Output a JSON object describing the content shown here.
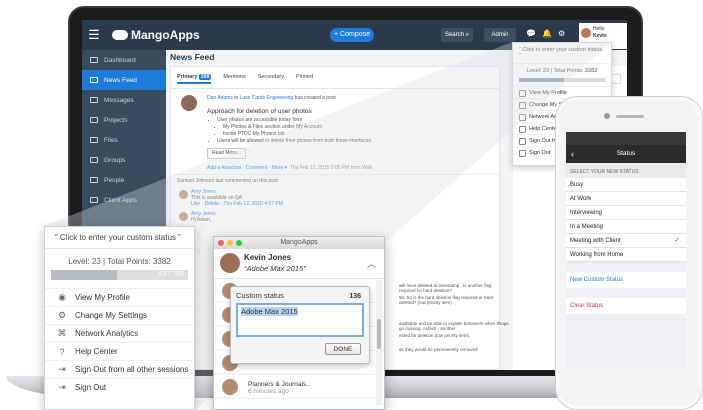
{
  "app": {
    "logo": "MangoApps",
    "compose": "+ Compose",
    "search": "Search",
    "admin": "Admin",
    "hello": "Hello",
    "user": "Kevin"
  },
  "sidebar": {
    "items": [
      {
        "label": "Dashboard",
        "active": false
      },
      {
        "label": "News Feed",
        "active": true
      },
      {
        "label": "Messages",
        "active": false
      },
      {
        "label": "Projects",
        "active": false
      },
      {
        "label": "Files",
        "active": false
      },
      {
        "label": "Groups",
        "active": false
      },
      {
        "label": "People",
        "active": false
      },
      {
        "label": "Client Apps",
        "active": false
      }
    ]
  },
  "feed": {
    "title": "News Feed",
    "tabs": {
      "primary": "Primary",
      "primary_count": "298",
      "mentions": "Mentions",
      "secondary": "Secondary",
      "pinned": "Pinned"
    },
    "post": {
      "author": "Dan Adams",
      "in": "in",
      "team": "Luxe Cards Engineering",
      "action": "has created a post",
      "title": "Approach for deletion of user photos",
      "bullets": [
        "User photos are accessible today form",
        "My Photos & Files section under My Account",
        "Inside PTDC My Photos tab",
        "Users will be allowed to delete their photos from both these interfaces."
      ],
      "read_more": "Read More...",
      "reactions": "Add a Reaction · Comment · More ▾",
      "meta": "Thu Feb 12, 2015 3:05 PM from Web"
    },
    "last_comment": "Samuel Johnson last commented on this post",
    "comments": [
      {
        "author": "Amy Jones",
        "text": "This is available on QA",
        "links": "Like · Delete · Thu Feb 12, 2015 4:07 PM"
      },
      {
        "author": "Amy Jones",
        "text": "Hi Adam,",
        "links": ""
      }
    ],
    "right_text": [
      "will have deleted at timestamp . Is another flag required for hard deletion?",
      "50. So is the hard deletion flag required or hard deleted? (low priority item)",
      "auditable and be able to explain behaviors when things go missing. Ashish - another",
      "ested for deletion (low priority item).",
      "as they would be permanently removed"
    ]
  },
  "small_status": {
    "custom": "“ Click to enter your custom status ”",
    "level": "Level: 23",
    "points": "Total Points: 3382",
    "items": [
      "View My Profile",
      "Change My Settings",
      "Network Analytics",
      "Help Center",
      "Sign Out from",
      "Sign Out"
    ]
  },
  "status_menu": {
    "custom": "“ Click to enter your custom status ”",
    "level": "Level: 23",
    "points": "Total Points: 3382",
    "bar_label": "53 / 758",
    "level_progress": 0.48,
    "items": [
      {
        "label": "View My Profile",
        "icon": "profile-icon"
      },
      {
        "label": "Change My Settings",
        "icon": "gear-icon"
      },
      {
        "label": "Network Analytics",
        "icon": "analytics-icon"
      },
      {
        "label": "Help Center",
        "icon": "help-icon"
      },
      {
        "label": "Sign Out from all other sessions",
        "icon": "signout-all-icon"
      },
      {
        "label": "Sign Out",
        "icon": "signout-icon"
      }
    ]
  },
  "chat": {
    "window_title": "MangoApps",
    "name": "Kevin Jones",
    "status": "“Adobe Max 2015”",
    "rows": [
      {
        "title": "",
        "sub": "ago"
      },
      {
        "title": "",
        "sub": "ago"
      },
      {
        "title": "",
        "sub": "3 minutes ago"
      },
      {
        "title": "",
        "sub": "5 minutes ago"
      },
      {
        "title": "Planners & Journals..",
        "sub": "6 minutes ago"
      }
    ]
  },
  "status_popover": {
    "label": "Custom status",
    "count": "136",
    "value": "Adobe Max 2015",
    "done": "DONE"
  },
  "phone": {
    "title": "Status",
    "section": "SELECT YOUR NEW STATUS",
    "options": [
      {
        "label": "Busy",
        "selected": false
      },
      {
        "label": "At Work",
        "selected": false
      },
      {
        "label": "Interviewing",
        "selected": false
      },
      {
        "label": "In a Meeting",
        "selected": false
      },
      {
        "label": "Meeting with Client",
        "selected": true
      },
      {
        "label": "Working from Home",
        "selected": false
      }
    ],
    "new_custom": "New Custom Status",
    "clear": "Clear Status"
  },
  "colors": {
    "accent": "#1f7bd9",
    "topbar": "#2b3a4a",
    "sidebar": "#394b5d",
    "danger": "#e0382b"
  }
}
